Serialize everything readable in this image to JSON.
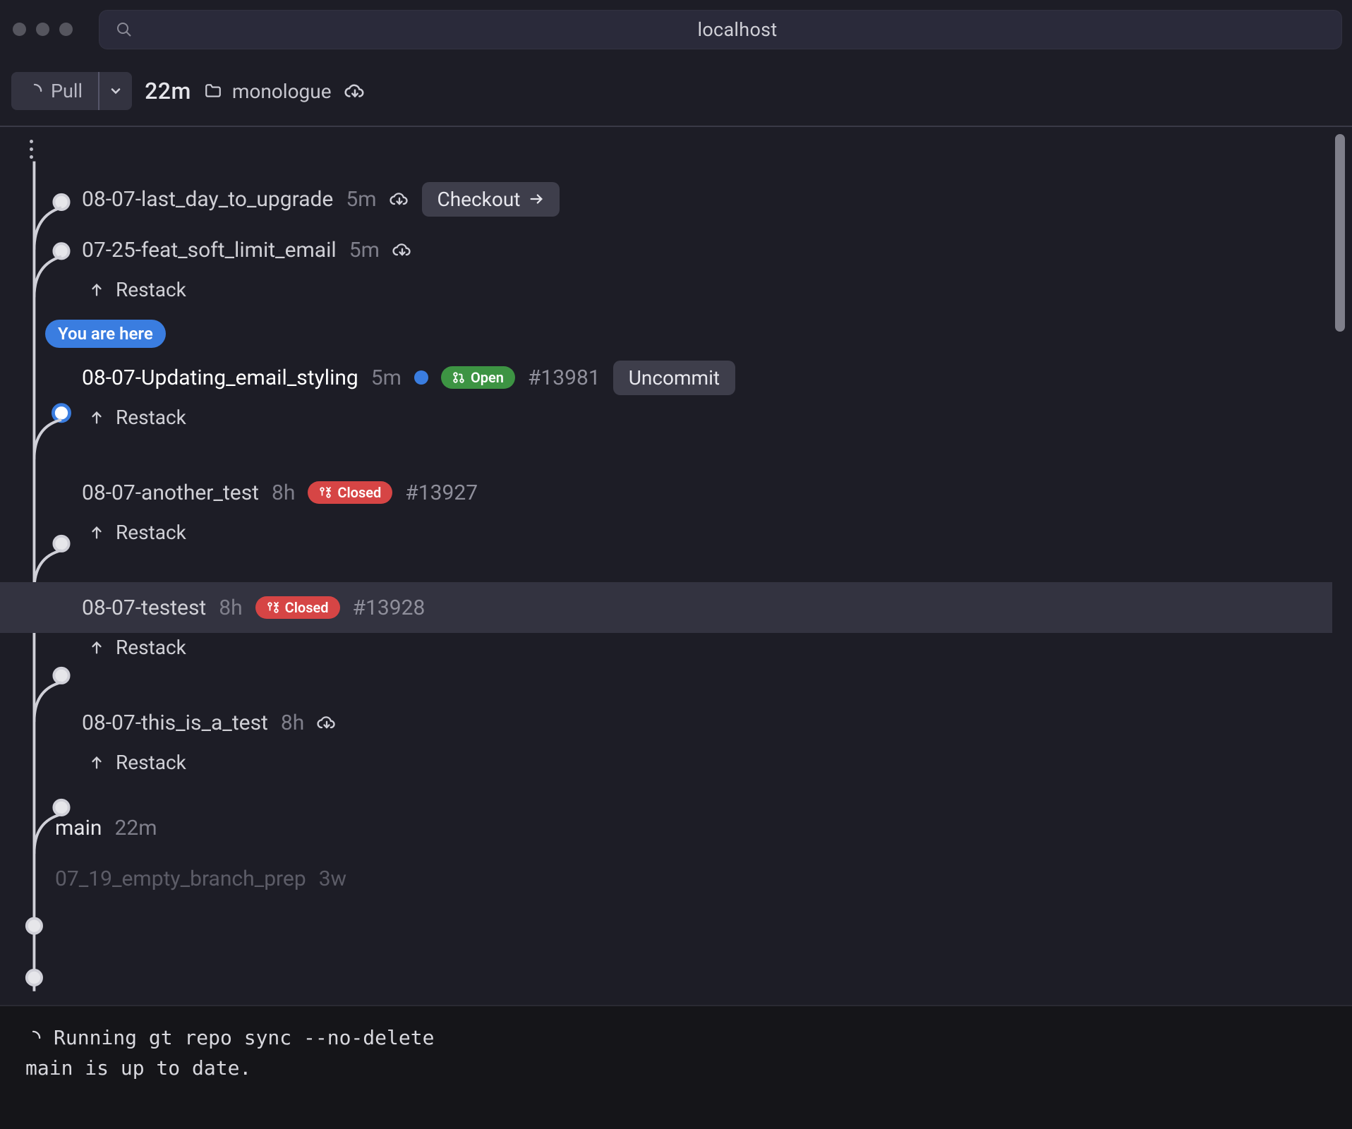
{
  "addressbar": {
    "host": "localhost"
  },
  "toolbar": {
    "pull_label": "Pull",
    "age": "22m",
    "repo_name": "monologue"
  },
  "you_are_here_label": "You are here",
  "checkout_label": "Checkout",
  "uncommit_label": "Uncommit",
  "restack_label": "Restack",
  "pr_labels": {
    "open": "Open",
    "closed": "Closed"
  },
  "branches": [
    {
      "name": "08-07-last_day_to_upgrade",
      "age": "5m",
      "cloud": true
    },
    {
      "name": "07-25-feat_soft_limit_email",
      "age": "5m",
      "cloud": true
    },
    {
      "name": "08-07-Updating_email_styling",
      "age": "5m",
      "pr": "#13981",
      "pr_state": "open",
      "current": true
    },
    {
      "name": "08-07-another_test",
      "age": "8h",
      "pr": "#13927",
      "pr_state": "closed"
    },
    {
      "name": "08-07-testest",
      "age": "8h",
      "pr": "#13928",
      "pr_state": "closed"
    },
    {
      "name": "08-07-this_is_a_test",
      "age": "8h",
      "cloud": true
    },
    {
      "name": "main",
      "age": "22m"
    },
    {
      "name": "07_19_empty_branch_prep",
      "age": "3w"
    }
  ],
  "terminal": {
    "lines": [
      "Running gt repo sync --no-delete",
      "main is up to date."
    ]
  }
}
